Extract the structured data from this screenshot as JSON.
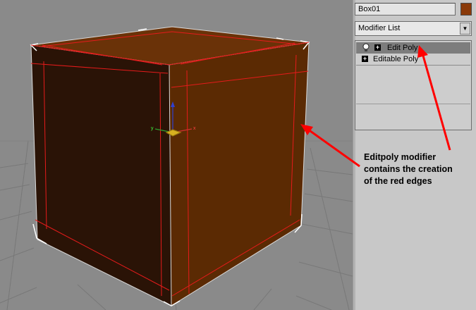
{
  "object_name": {
    "value": "Box01"
  },
  "object_color": "#8a3a0a",
  "modifier_list": {
    "label": "Modifier List"
  },
  "stack_items": [
    {
      "label": "Edit Poly",
      "selected": true,
      "icons": [
        "lightbulb-icon",
        "expand-plus-icon"
      ]
    },
    {
      "label": "Editable Poly",
      "selected": false,
      "icons": [
        "expand-plus-icon"
      ]
    }
  ],
  "annotation": {
    "lines": [
      "Editpoly modifier",
      "contains the creation",
      "of the red edges"
    ]
  },
  "colors": {
    "viewport_background": "#8a8a8a",
    "box_face": "#5e2a06",
    "red_edges": "#e61b1b",
    "selection_highlight": "#7d7d7d",
    "arrow": "#ff0000"
  },
  "icons": [
    "chevron-down-icon",
    "lightbulb-icon",
    "expand-plus-icon",
    "axis-gizmo-icon"
  ]
}
